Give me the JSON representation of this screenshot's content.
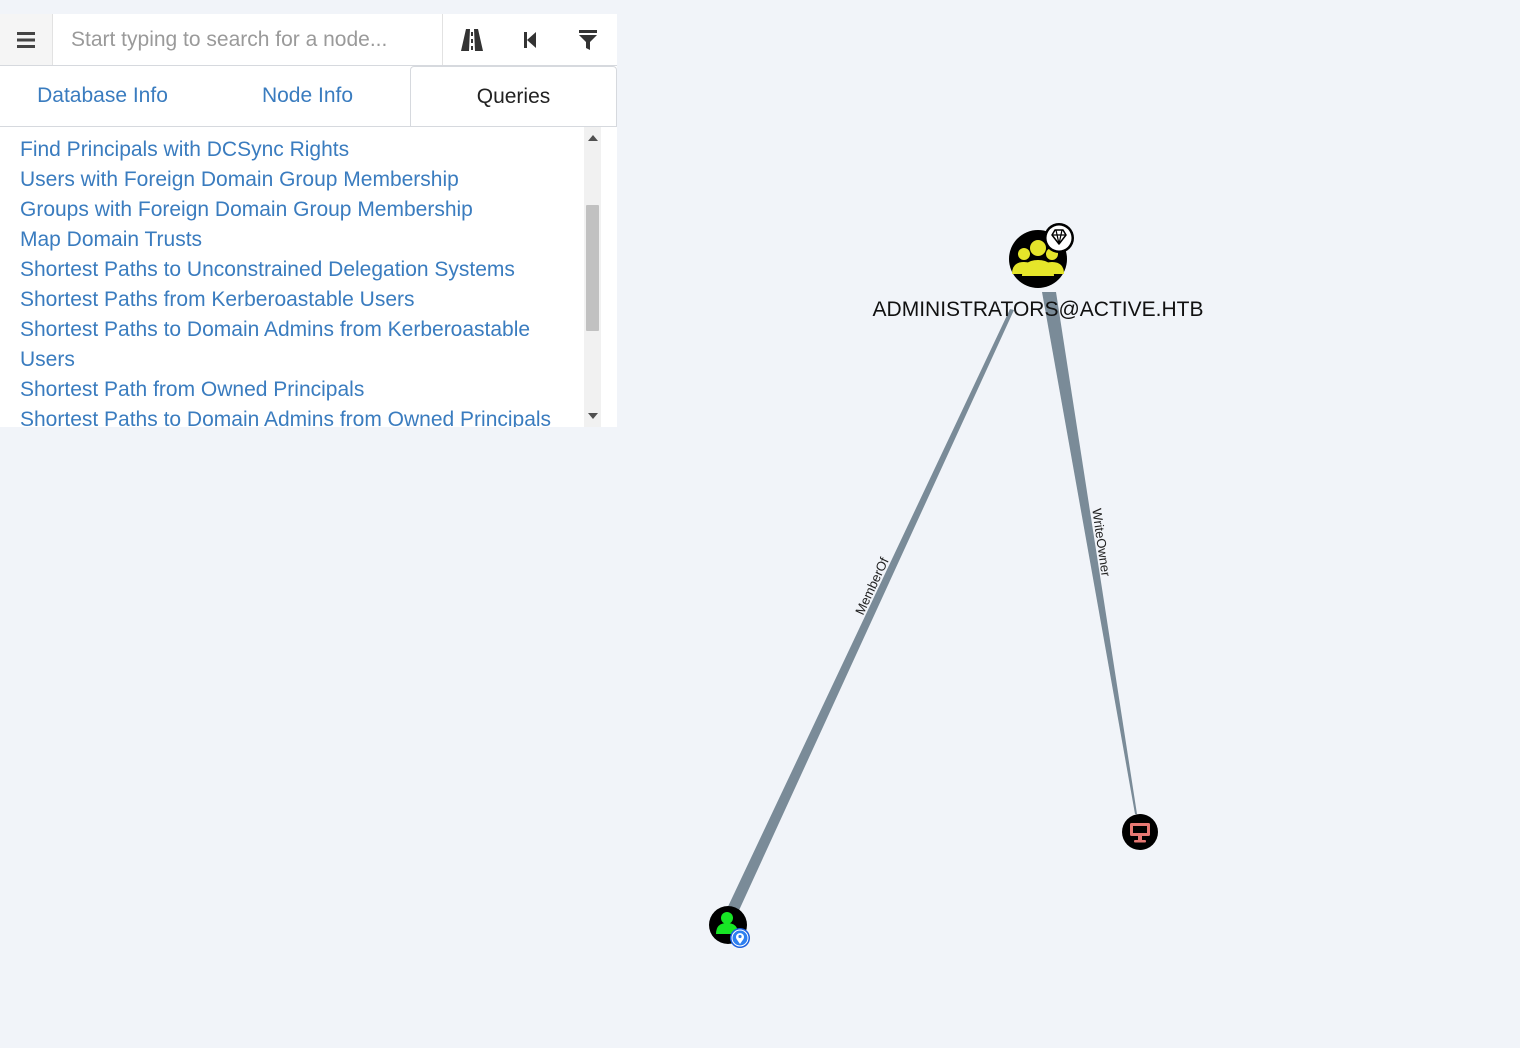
{
  "search": {
    "placeholder": "Start typing to search for a node..."
  },
  "toolbar": {
    "menu_icon": "hamburger-menu-icon",
    "pathfinding_icon": "road-icon",
    "back_icon": "step-backward-icon",
    "filter_icon": "filter-icon"
  },
  "tabs": [
    {
      "label": "Database Info",
      "active": false
    },
    {
      "label": "Node Info",
      "active": false
    },
    {
      "label": "Queries",
      "active": true
    }
  ],
  "queries": [
    "Find Principals with DCSync Rights",
    "Users with Foreign Domain Group Membership",
    "Groups with Foreign Domain Group Membership",
    "Map Domain Trusts",
    "Shortest Paths to Unconstrained Delegation Systems",
    "Shortest Paths from Kerberoastable Users",
    "Shortest Paths to Domain Admins from Kerberoastable Users",
    "Shortest Path from Owned Principals",
    "Shortest Paths to Domain Admins from Owned Principals"
  ],
  "graph": {
    "nodes": {
      "group": {
        "label": "ADMINISTRATORS@ACTIVE.HTB",
        "type": "group",
        "color": "#e5e52a",
        "highvalue": true
      },
      "user": {
        "label": "",
        "type": "user",
        "color": "#17e625",
        "owned": true
      },
      "computer": {
        "label": "",
        "type": "computer",
        "color": "#e67873"
      }
    },
    "edges": {
      "memberof": {
        "label": "MemberOf",
        "from": "user",
        "to": "group"
      },
      "writeowner": {
        "label": "WriteOwner",
        "from": "group",
        "to": "computer"
      }
    },
    "edge_color": "#7a8b98"
  }
}
